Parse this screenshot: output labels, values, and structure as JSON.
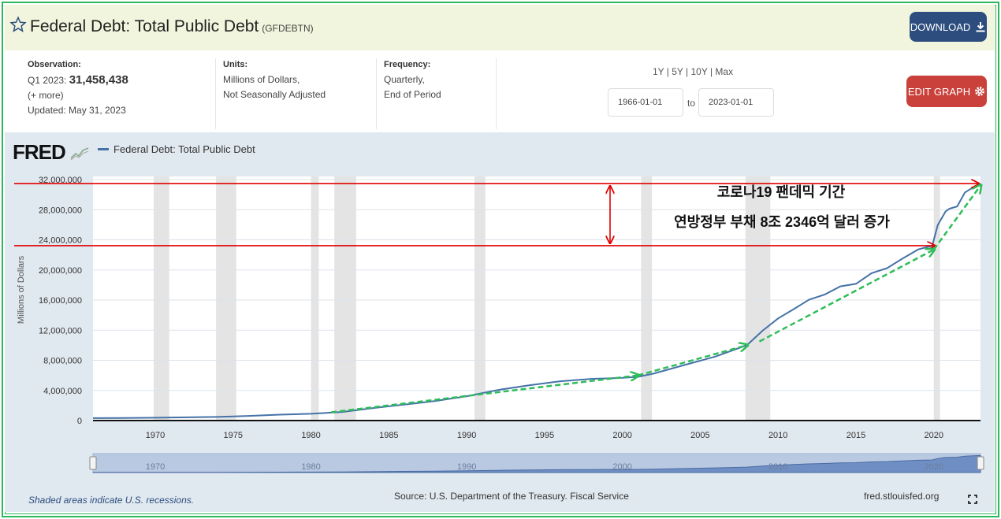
{
  "header": {
    "title": "Federal Debt: Total Public Debt",
    "series_id": "(GFDEBTN)",
    "download_label": "DOWNLOAD",
    "background": "#f2f5dd"
  },
  "info": {
    "observation_label": "Observation:",
    "observation_period": "Q1 2023:",
    "observation_value": "31,458,438",
    "more": "(+ more)",
    "updated": "Updated: May 31, 2023",
    "units_label": "Units:",
    "units_line1": "Millions of Dollars,",
    "units_line2": "Not Seasonally Adjusted",
    "frequency_label": "Frequency:",
    "frequency_line1": "Quarterly,",
    "frequency_line2": "End of Period",
    "range_options": "1Y | 5Y | 10Y | Max",
    "start_date": "1966-01-01",
    "to_label": "to",
    "end_date": "2023-01-01",
    "edit_label": "EDIT GRAPH"
  },
  "colors": {
    "download_button": "#2c4d7e",
    "edit_button": "#c9413a",
    "series_line": "#4572a7",
    "chart_background": "#e1e9f0",
    "recession_shade": "#e4e4e4",
    "annotation_red": "#e00000",
    "trend_green": "#2ebd59",
    "frame_green": "#2eb85c"
  },
  "chart": {
    "logo": "FRED",
    "legend_label": "Federal Debt: Total Public Debt",
    "annotation_line1": "코로나19 팬데믹 기간",
    "annotation_line2": "연방정부 부채 8조 2346억 달러 증가",
    "navigator_ticks": [
      "1970",
      "1980",
      "1990",
      "2000",
      "2010",
      "2020"
    ]
  },
  "chart_data": {
    "type": "line",
    "title": "",
    "ylabel": "Millions of Dollars",
    "xlabel": "",
    "xlim": [
      1966,
      2023
    ],
    "ylim": [
      0,
      32000000
    ],
    "x_ticks": [
      1970,
      1975,
      1980,
      1985,
      1990,
      1995,
      2000,
      2005,
      2010,
      2015,
      2020
    ],
    "y_ticks": [
      "0",
      "4,000,000",
      "8,000,000",
      "12,000,000",
      "16,000,000",
      "20,000,000",
      "24,000,000",
      "28,000,000",
      "32,000,000"
    ],
    "grid": true,
    "legend_position": "top-left",
    "recessions": [
      [
        1969.9,
        1970.9
      ],
      [
        1973.9,
        1975.2
      ],
      [
        1980.0,
        1980.5
      ],
      [
        1981.5,
        1982.9
      ],
      [
        1990.5,
        1991.2
      ],
      [
        2001.2,
        2001.9
      ],
      [
        2007.9,
        2009.5
      ],
      [
        2020.0,
        2020.4
      ]
    ],
    "series": [
      {
        "name": "Federal Debt: Total Public Debt",
        "x": [
          1966,
          1968,
          1970,
          1972,
          1974,
          1976,
          1978,
          1980,
          1982,
          1984,
          1986,
          1988,
          1990,
          1992,
          1994,
          1996,
          1998,
          2000,
          2001,
          2002,
          2004,
          2006,
          2008,
          2009,
          2010,
          2011,
          2012,
          2013,
          2014,
          2015,
          2016,
          2017,
          2018,
          2019,
          2019.9,
          2020.25,
          2020.75,
          2021,
          2021.5,
          2022,
          2022.5,
          2023
        ],
        "values": [
          320000,
          350000,
          380000,
          430000,
          480000,
          620000,
          780000,
          900000,
          1140000,
          1660000,
          2120000,
          2600000,
          3230000,
          4060000,
          4690000,
          5220000,
          5530000,
          5670000,
          5800000,
          6230000,
          7380000,
          8510000,
          10020000,
          11920000,
          13560000,
          14790000,
          16060000,
          16740000,
          17820000,
          18150000,
          19570000,
          20240000,
          21520000,
          22720000,
          23220000,
          25950000,
          27750000,
          28130000,
          28430000,
          30290000,
          30930000,
          31458438
        ]
      }
    ],
    "annotations": [
      "코로나19 팬데믹 기간",
      "연방정부 부채 8조 2346억 달러 증가"
    ]
  },
  "footer": {
    "recession_note": "Shaded areas indicate U.S. recessions.",
    "source": "Source: U.S. Department of the Treasury. Fiscal Service",
    "site": "fred.stlouisfed.org"
  }
}
